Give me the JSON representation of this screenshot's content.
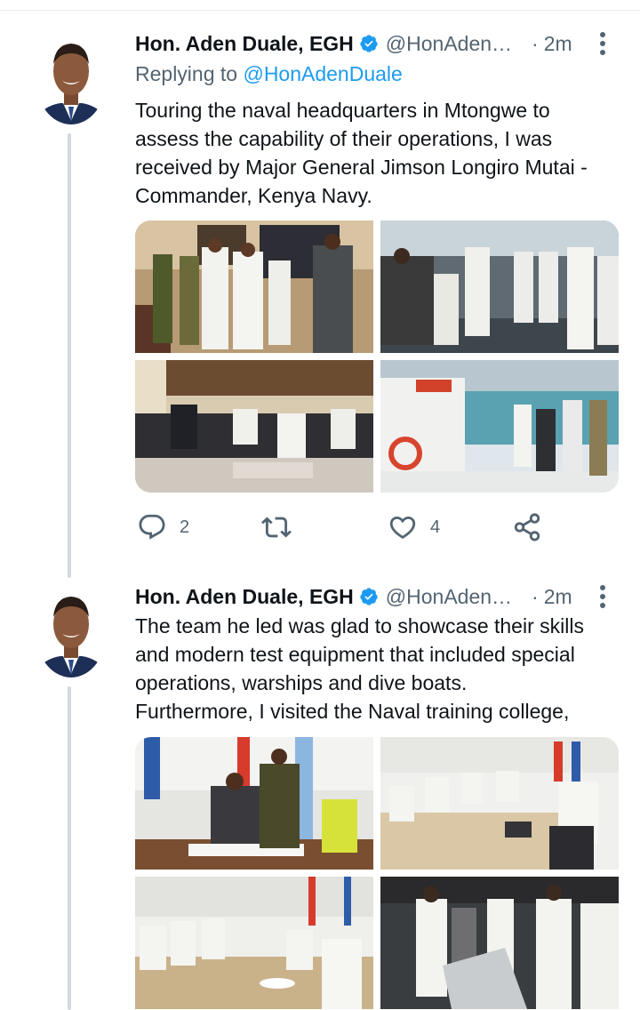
{
  "tweets": [
    {
      "author": {
        "name": "Hon. Aden Duale, EGH",
        "handle": "@HonAden…",
        "avatar_icon": "profile-photo"
      },
      "time": "2m",
      "replying_to_label": "Replying to",
      "replying_to_handle": "@HonAdenDuale",
      "text_lines": [
        "Touring the naval headquarters in Mtongwe to",
        "assess the capability of their operations, I was",
        "received by Major General Jimson Longiro Mutai -",
        "Commander, Kenya Navy."
      ],
      "photos": [
        "officials-standing-in-office",
        "officers-on-ship-bridge",
        "officials-seated-in-lounge",
        "officials-on-boat-deck"
      ],
      "actions": {
        "reply_count": "2",
        "retweet_count": "",
        "like_count": "4"
      }
    },
    {
      "author": {
        "name": "Hon. Aden Duale, EGH",
        "handle": "@HonAden…",
        "avatar_icon": "profile-photo"
      },
      "time": "2m",
      "text_lines": [
        "The team he led was glad to showcase their skills",
        "and modern test equipment that included special",
        "operations, warships and dive boats.",
        "Furthermore, I visited the Naval training college,"
      ],
      "photos": [
        "signing-visitors-book",
        "meeting-in-conference-room",
        "officers-around-conference-table",
        "officers-at-simulator-console"
      ]
    }
  ],
  "colors": {
    "text": "#0f1419",
    "muted": "#536471",
    "link": "#1d9bf0",
    "verified": "#1d9bf0",
    "thread_line": "#cfd9de"
  },
  "icons": {
    "verified": "verified-badge-icon",
    "more": "more-vertical-icon",
    "reply": "reply-icon",
    "retweet": "retweet-icon",
    "like": "heart-icon",
    "share": "share-icon"
  },
  "separator_dot": "·"
}
